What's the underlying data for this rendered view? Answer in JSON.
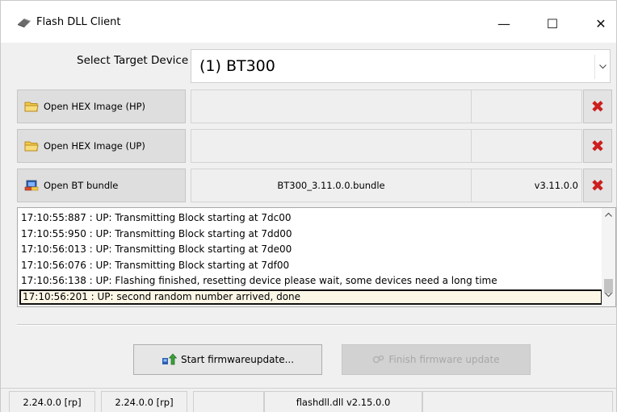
{
  "window": {
    "title": "Flash DLL Client",
    "minimize_glyph": "—",
    "maximize_glyph": "☐",
    "close_glyph": "✕"
  },
  "device_select": {
    "label": "Select Target Device",
    "value": "(1) BT300"
  },
  "file_rows": [
    {
      "button_label": "Open HEX Image (HP)",
      "icon": "folder-icon",
      "path": "",
      "version": ""
    },
    {
      "button_label": "Open HEX Image (UP)",
      "icon": "folder-icon",
      "path": "",
      "version": ""
    },
    {
      "button_label": "Open BT bundle",
      "icon": "bundle-icon",
      "path": "BT300_3.11.0.0.bundle",
      "version": "v3.11.0.0"
    }
  ],
  "log": {
    "lines": [
      "17:10:55:887 : UP: Transmitting Block starting at 7dc00",
      "17:10:55:950 : UP: Transmitting Block starting at 7dd00",
      "17:10:56:013 : UP: Transmitting Block starting at 7de00",
      "17:10:56:076 : UP: Transmitting Block starting at 7df00",
      "17:10:56:138 : UP: Flashing finished, resetting device please wait, some devices need a long time",
      "17:10:56:201 : UP: second random number arrived, done"
    ],
    "selected_index": 5
  },
  "actions": {
    "start_label": "Start firmwareupdate...",
    "finish_label": "Finish firmware update",
    "finish_enabled": false
  },
  "status_bar": {
    "cells": [
      "2.24.0.0 [rp]",
      "2.24.0.0 [rp]",
      "",
      "flashdll.dll v2.15.0.0",
      ""
    ]
  },
  "colors": {
    "remove_red": "#cc1f1f",
    "selection_bg": "#fbf6e6",
    "folder_yellow": "#f2c94c"
  }
}
